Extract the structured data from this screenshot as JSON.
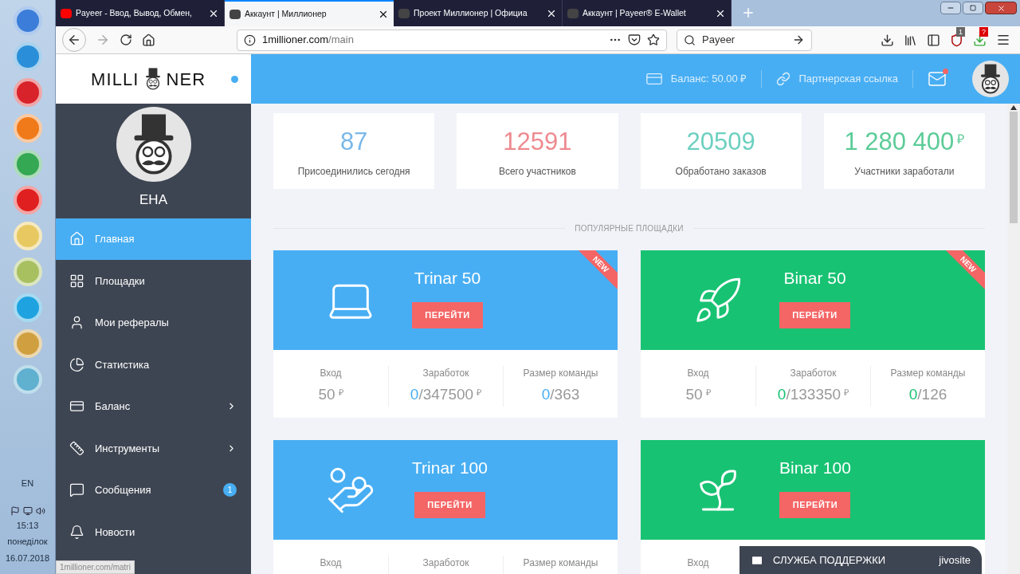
{
  "taskbar": {
    "apps": [
      {
        "color": "#3b7dd8"
      },
      {
        "color": "#2a8fd8"
      },
      {
        "color": "#d8232a"
      },
      {
        "color": "#f07a1a"
      },
      {
        "color": "#34a853"
      },
      {
        "color": "#e02020"
      },
      {
        "color": "#e8c860"
      },
      {
        "color": "#a8c060"
      },
      {
        "color": "#1fa3e0"
      },
      {
        "color": "#d0a040"
      },
      {
        "color": "#60b0d0"
      }
    ],
    "language": "EN",
    "time": "15:13",
    "weekday": "понеділок",
    "date": "16.07.2018"
  },
  "browser": {
    "tabs": [
      {
        "title": "Payeer - Ввод, Вывод, Обмен,",
        "selected": false
      },
      {
        "title": "Аккаунт | Миллионер",
        "selected": true
      },
      {
        "title": "Проект Миллионер | Официа",
        "selected": false
      },
      {
        "title": "Аккаунт | Payeer® E-Wallet",
        "selected": false
      }
    ],
    "url_host": "1millioner.com",
    "url_path": "/main",
    "search_value": "Payeer",
    "ublock_count": "1",
    "addon_badge": "?",
    "status_url": "1millioner.com/matri"
  },
  "logo": {
    "left": "MILLI",
    "right": "NER"
  },
  "header": {
    "balance": "Баланс: 50.00 ₽",
    "referral_link": "Партнерская ссылка",
    "has_unread_mail": true
  },
  "user": {
    "name": "ЕНА"
  },
  "sidebar": {
    "items": [
      {
        "label": "Главная",
        "selected": true
      },
      {
        "label": "Площадки",
        "selected": false
      },
      {
        "label": "Мои рефералы",
        "selected": false
      },
      {
        "label": "Статистика",
        "selected": false
      },
      {
        "label": "Баланс",
        "selected": false,
        "expandable": true
      },
      {
        "label": "Инструменты",
        "selected": false,
        "expandable": true
      },
      {
        "label": "Сообщения",
        "selected": false,
        "badge": "1"
      },
      {
        "label": "Новости",
        "selected": false
      }
    ]
  },
  "stats": [
    {
      "value": "87",
      "label": "Присоединились сегодня",
      "color": "#7ab8e8"
    },
    {
      "value": "12591",
      "label": "Всего участников",
      "color": "#ee8a90"
    },
    {
      "value": "20509",
      "label": "Обработано заказов",
      "color": "#6cd0c0"
    },
    {
      "value": "1 280 400",
      "currency": "₽",
      "label": "Участники заработали",
      "color": "#5ccc98"
    }
  ],
  "section_title": "ПОПУЛЯРНЫЕ ПЛОЩАДКИ",
  "platforms": [
    {
      "name": "Trinar 50",
      "button": "ПЕРЕЙТИ",
      "ribbon": "NEW",
      "color": "#48aef3",
      "fields": [
        {
          "label": "Вход",
          "value": "50",
          "currency": "₽"
        },
        {
          "label": "Заработок",
          "done": "0",
          "value": "/347500",
          "currency": "₽"
        },
        {
          "label": "Размер команды",
          "done": "0",
          "value": "/363"
        }
      ]
    },
    {
      "name": "Binar 50",
      "button": "ПЕРЕЙТИ",
      "ribbon": "NEW",
      "color": "#18c273",
      "fields": [
        {
          "label": "Вход",
          "value": "50",
          "currency": "₽"
        },
        {
          "label": "Заработок",
          "done": "0",
          "value": "/133350",
          "currency": "₽"
        },
        {
          "label": "Размер команды",
          "done": "0",
          "value": "/126"
        }
      ]
    },
    {
      "name": "Trinar 100",
      "button": "ПЕРЕЙТИ",
      "color": "#48aef3",
      "fields": [
        {
          "label": "Вход"
        },
        {
          "label": "Заработок"
        },
        {
          "label": "Размер команды"
        }
      ]
    },
    {
      "name": "Binar 100",
      "button": "ПЕРЕЙТИ",
      "color": "#18c273",
      "fields": [
        {
          "label": "Вход"
        }
      ]
    }
  ],
  "support_chat": {
    "label": "СЛУЖБА ПОДДЕРЖКИ",
    "brand": "jivosite"
  }
}
